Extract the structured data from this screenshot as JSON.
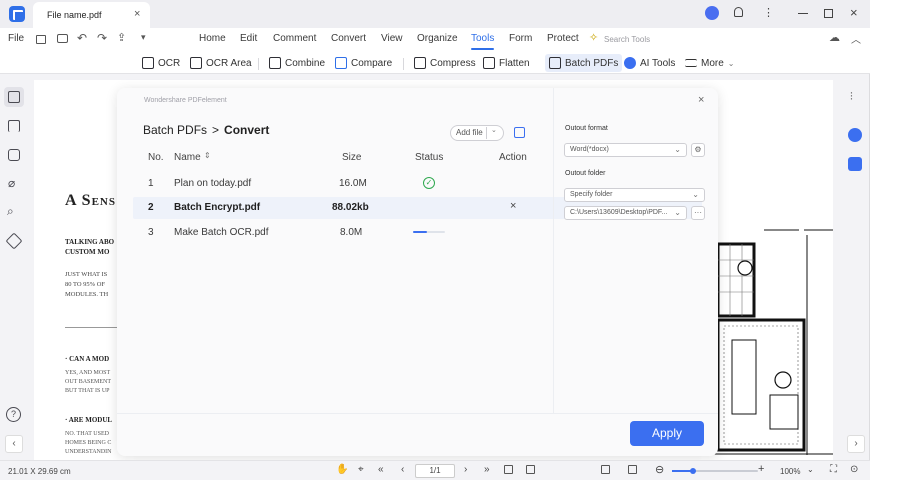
{
  "titlebar": {
    "tab_title": "File name.pdf",
    "close_tab": "×"
  },
  "menu": {
    "file": "File",
    "items": [
      "Home",
      "Edit",
      "Comment",
      "Convert",
      "View",
      "Organize",
      "Tools",
      "Form",
      "Protect"
    ],
    "active": "Tools",
    "search_placeholder": "Search Tools"
  },
  "toolbar": {
    "items": [
      {
        "label": "OCR",
        "icon": "ocr-icon"
      },
      {
        "label": "OCR Area",
        "icon": "ocr-area-icon"
      },
      {
        "label": "Combine",
        "icon": "combine-icon"
      },
      {
        "label": "Compare",
        "icon": "compare-icon"
      },
      {
        "label": "Compress",
        "icon": "compress-icon"
      },
      {
        "label": "Flatten",
        "icon": "flatten-icon"
      },
      {
        "label": "Batch PDFs",
        "icon": "batch-icon"
      },
      {
        "label": "AI Tools",
        "icon": "ai-icon"
      },
      {
        "label": "More",
        "icon": "more-icon"
      }
    ],
    "selected": "Batch PDFs"
  },
  "document": {
    "heading": "A Sens",
    "sub1_line1": "Talking Abo",
    "sub1_line2": "Custom Mo",
    "para1_line1": "Just What Is",
    "para1_line2": "80 to 95% Of",
    "para1_line3": "Modules. Th",
    "q1": "· Can A Mod",
    "q1_line1": "Yes, And Most",
    "q1_line2": "Out Basement",
    "q1_line3": "But That Is Up",
    "q2": "· Are Modul",
    "q2_line1": "No. That Used",
    "q2_line2": "Homes Being C",
    "q2_line3": "Understandin"
  },
  "dialog": {
    "brand": "Wondershare PDFelement",
    "close": "×",
    "crumb_parent": "Batch PDFs",
    "crumb_sep": ">",
    "crumb_current": "Convert",
    "add_file": "Add file",
    "columns": {
      "no": "No.",
      "name": "Name",
      "size": "Size",
      "status": "Status",
      "action": "Action"
    },
    "rows": [
      {
        "no": "1",
        "name": "Plan on today.pdf",
        "size": "16.0M",
        "status": "done"
      },
      {
        "no": "2",
        "name": "Batch Encrypt.pdf",
        "size": "88.02kb",
        "status": "",
        "action": "×"
      },
      {
        "no": "3",
        "name": "Make Batch OCR.pdf",
        "size": "8.0M",
        "status": "progress",
        "progress": 0.45
      }
    ],
    "output_format_label": "Outout format",
    "output_format_value": "Word(*docx)",
    "output_folder_label": "Outout folder",
    "output_folder_value": "Specify folder",
    "output_path": "C:\\Users\\13609\\Desktop\\PDF...",
    "path_more": "···",
    "apply": "Apply"
  },
  "statusbar": {
    "page_size": "21.01 X 29.69 cm",
    "page_indicator": "1/1",
    "zoom": "100%",
    "zoom_plus": "+"
  },
  "colors": {
    "accent": "#3b6ff0",
    "success": "#2fa84f"
  }
}
